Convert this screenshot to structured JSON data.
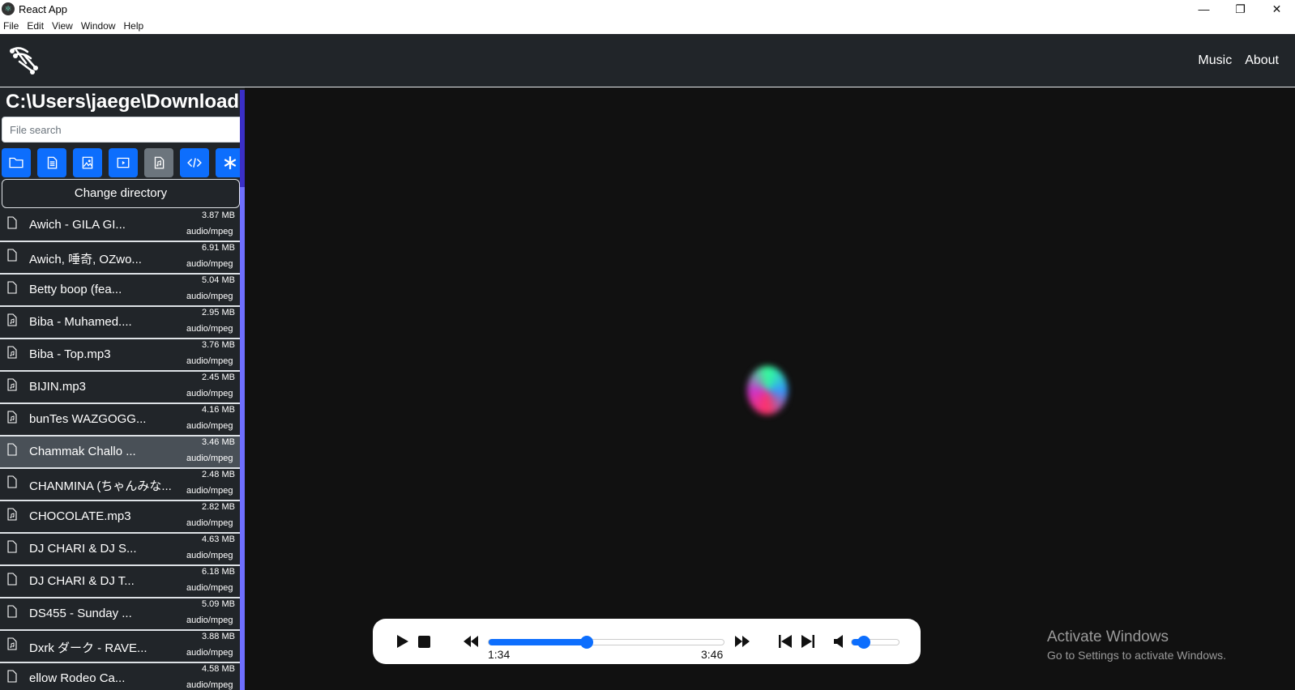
{
  "window": {
    "title": "React App",
    "minimize_glyph": "—",
    "restore_glyph": "❐",
    "close_glyph": "✕"
  },
  "menubar": {
    "items": [
      "File",
      "Edit",
      "View",
      "Window",
      "Help"
    ]
  },
  "navbar": {
    "links": [
      "Music",
      "About"
    ]
  },
  "sidebar": {
    "path": "C:\\Users\\jaege\\Downloads",
    "search_placeholder": "File search",
    "filters": [
      {
        "icon": "folder-icon",
        "active": false
      },
      {
        "icon": "document-icon",
        "active": false
      },
      {
        "icon": "image-icon",
        "active": false
      },
      {
        "icon": "video-icon",
        "active": false
      },
      {
        "icon": "music-file-icon",
        "active": true
      },
      {
        "icon": "code-icon",
        "active": false
      },
      {
        "icon": "asterisk-icon",
        "active": false
      }
    ],
    "change_directory_label": "Change directory",
    "files": [
      {
        "name": "Awich - GILA GI...",
        "size": "3.87 MB",
        "type": "audio/mpeg",
        "icon": "file-icon",
        "selected": false
      },
      {
        "name": "Awich, 唾奇, OZwo...",
        "size": "6.91 MB",
        "type": "audio/mpeg",
        "icon": "file-icon",
        "selected": false
      },
      {
        "name": "Betty boop (fea...",
        "size": "5.04 MB",
        "type": "audio/mpeg",
        "icon": "file-icon",
        "selected": false
      },
      {
        "name": "Biba - Muhamed....",
        "size": "2.95 MB",
        "type": "audio/mpeg",
        "icon": "music-file-icon",
        "selected": false
      },
      {
        "name": "Biba - Top.mp3",
        "size": "3.76 MB",
        "type": "audio/mpeg",
        "icon": "music-file-icon",
        "selected": false
      },
      {
        "name": "BIJIN.mp3",
        "size": "2.45 MB",
        "type": "audio/mpeg",
        "icon": "music-file-icon",
        "selected": false
      },
      {
        "name": "bunTes WAZGOGG...",
        "size": "4.16 MB",
        "type": "audio/mpeg",
        "icon": "music-file-icon",
        "selected": false
      },
      {
        "name": "Chammak Challo ...",
        "size": "3.46 MB",
        "type": "audio/mpeg",
        "icon": "file-icon",
        "selected": true
      },
      {
        "name": "CHANMINA (ちゃんみな...",
        "size": "2.48 MB",
        "type": "audio/mpeg",
        "icon": "file-icon",
        "selected": false
      },
      {
        "name": "CHOCOLATE.mp3",
        "size": "2.82 MB",
        "type": "audio/mpeg",
        "icon": "music-file-icon",
        "selected": false
      },
      {
        "name": "DJ CHARI & DJ S...",
        "size": "4.63 MB",
        "type": "audio/mpeg",
        "icon": "file-icon",
        "selected": false
      },
      {
        "name": "DJ CHARI & DJ T...",
        "size": "6.18 MB",
        "type": "audio/mpeg",
        "icon": "file-icon",
        "selected": false
      },
      {
        "name": "DS455 - Sunday ...",
        "size": "5.09 MB",
        "type": "audio/mpeg",
        "icon": "file-icon",
        "selected": false
      },
      {
        "name": "Dxrk ダーク - RAVE...",
        "size": "3.88 MB",
        "type": "audio/mpeg",
        "icon": "music-file-icon",
        "selected": false
      },
      {
        "name": "ellow Rodeo Ca...",
        "size": "4.58 MB",
        "type": "audio/mpeg",
        "icon": "file-icon",
        "selected": false
      }
    ]
  },
  "player": {
    "current_time": "1:34",
    "duration": "3:46",
    "progress_fraction": 0.416,
    "volume_fraction": 0.25
  },
  "watermark": {
    "line1": "Activate Windows",
    "line2": "Go to Settings to activate Windows."
  },
  "colors": {
    "accent": "#0d6efd",
    "sidebar_bg": "#212529",
    "main_bg": "#111111"
  }
}
